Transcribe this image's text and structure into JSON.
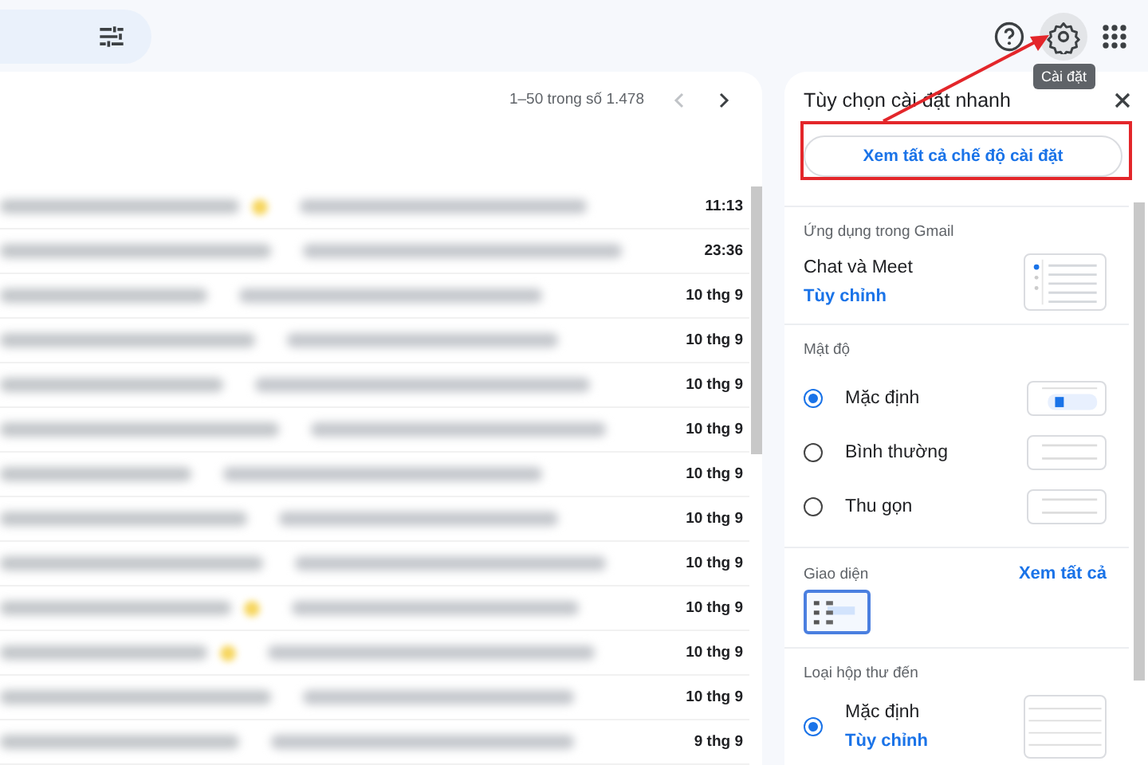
{
  "toolbar": {
    "tooltip": "Cài đặt"
  },
  "pager": {
    "range": "1–50 trong số 1.478"
  },
  "emails": [
    {
      "time": "11:13",
      "starred": true
    },
    {
      "time": "23:36",
      "starred": false
    },
    {
      "time": "10 thg 9",
      "starred": false
    },
    {
      "time": "10 thg 9",
      "starred": false
    },
    {
      "time": "10 thg 9",
      "starred": false
    },
    {
      "time": "10 thg 9",
      "starred": false
    },
    {
      "time": "10 thg 9",
      "starred": false
    },
    {
      "time": "10 thg 9",
      "starred": false
    },
    {
      "time": "10 thg 9",
      "starred": false
    },
    {
      "time": "10 thg 9",
      "starred": true
    },
    {
      "time": "10 thg 9",
      "starred": true
    },
    {
      "time": "10 thg 9",
      "starred": false
    },
    {
      "time": "9 thg 9",
      "starred": false
    }
  ],
  "quick_settings": {
    "title": "Tùy chọn cài đặt nhanh",
    "all_settings_button": "Xem tất cả chế độ cài đặt",
    "apps": {
      "heading": "Ứng dụng trong Gmail",
      "label": "Chat và Meet",
      "link": "Tùy chỉnh"
    },
    "density": {
      "heading": "Mật độ",
      "options": [
        {
          "label": "Mặc định",
          "selected": true
        },
        {
          "label": "Bình thường",
          "selected": false
        },
        {
          "label": "Thu gọn",
          "selected": false
        }
      ]
    },
    "theme": {
      "heading": "Giao diện",
      "link": "Xem tất cả"
    },
    "inbox_type": {
      "heading": "Loại hộp thư đến",
      "options": [
        {
          "label": "Mặc định",
          "link": "Tùy chỉnh",
          "selected": true
        }
      ]
    }
  }
}
